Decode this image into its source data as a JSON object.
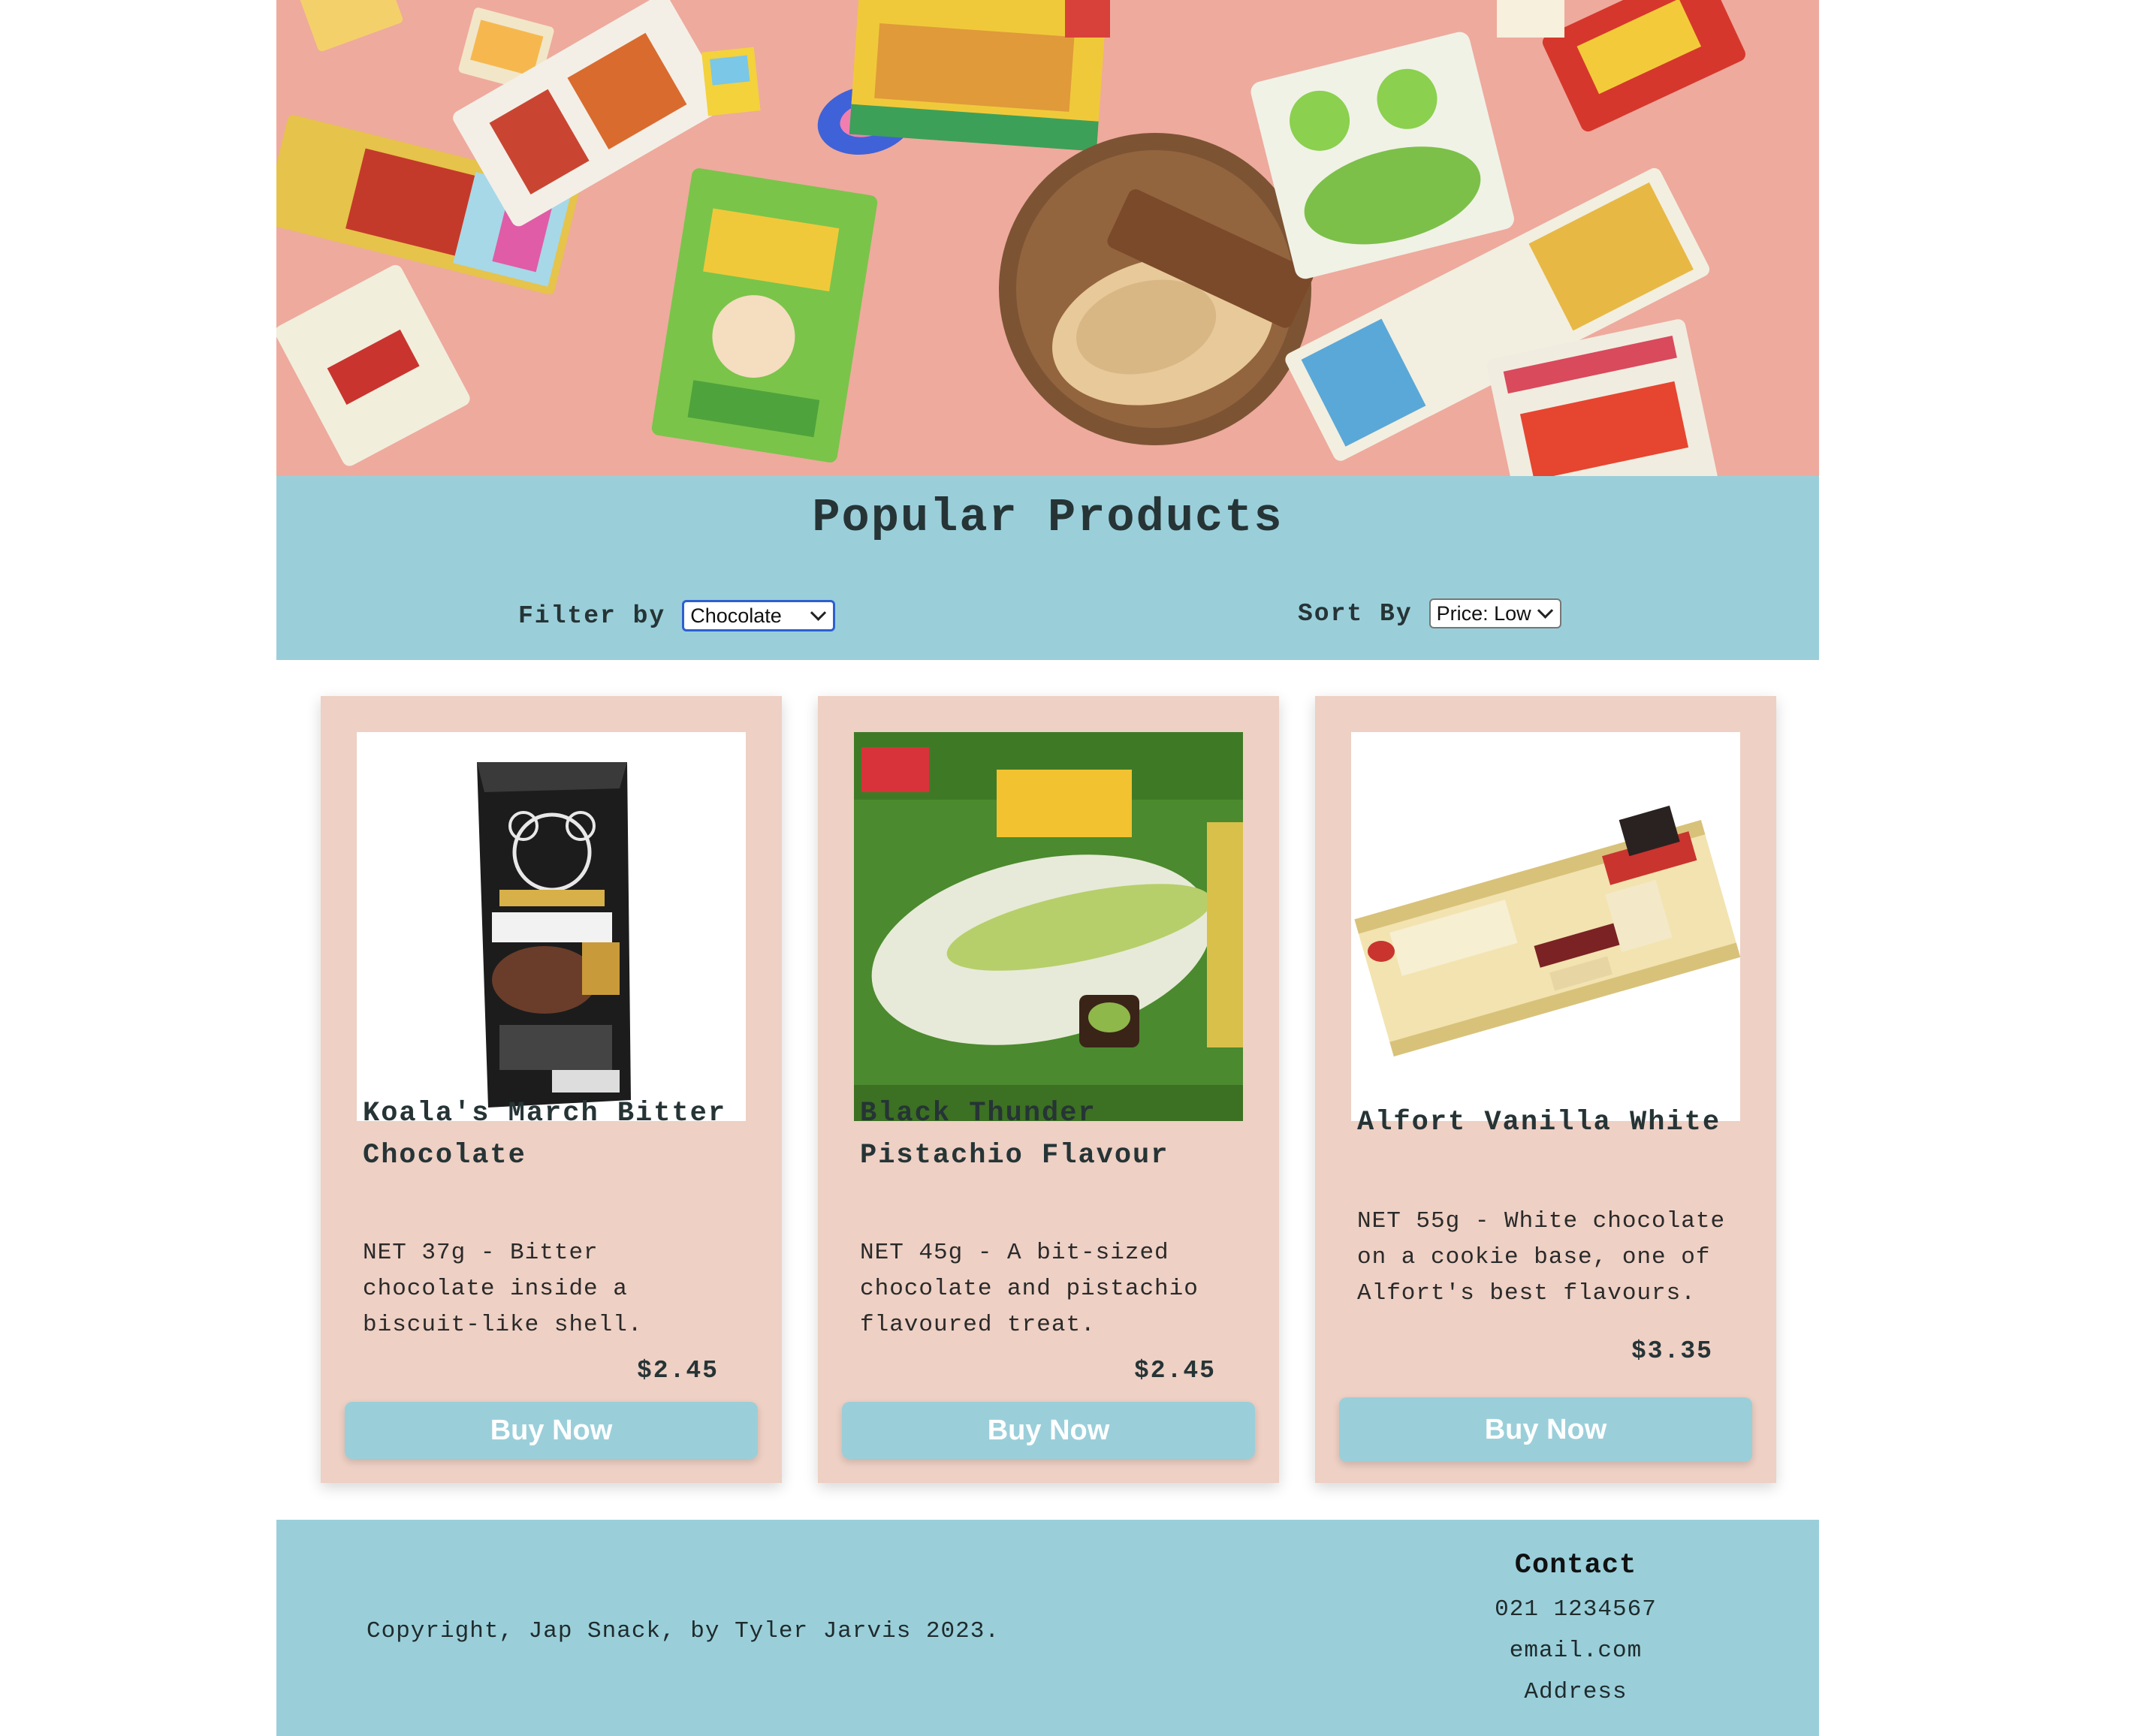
{
  "hero": {
    "image_alt": "Assorted Japanese snacks on a pink background"
  },
  "popular": {
    "title": "Popular Products",
    "filter_label": "Filter by",
    "filter_value": "Chocolate",
    "sort_label": "Sort By",
    "sort_value": "Price: Low"
  },
  "products": [
    {
      "name": "Koala's March Bitter Chocolate",
      "description": "NET 37g - Bitter chocolate inside a biscuit-like shell.",
      "price": "$2.45",
      "button": "Buy Now"
    },
    {
      "name": "Black Thunder Pistachio Flavour",
      "description": "NET 45g - A bit-sized chocolate and pistachio flavoured treat.",
      "price": "$2.45",
      "button": "Buy Now"
    },
    {
      "name": "Alfort Vanilla White",
      "description": "NET 55g - White chocolate on a cookie base, one of Alfort's best flavours.",
      "price": "$3.35",
      "button": "Buy Now"
    }
  ],
  "footer": {
    "copyright": "Copyright, Jap Snack, by Tyler Jarvis 2023.",
    "contact_title": "Contact",
    "phone": "021 1234567",
    "email": "email.com",
    "address": "Address"
  },
  "colors": {
    "accent": "#9acfda",
    "card_bg": "#eed0c4",
    "hero_bg": "#eeaa9d"
  }
}
